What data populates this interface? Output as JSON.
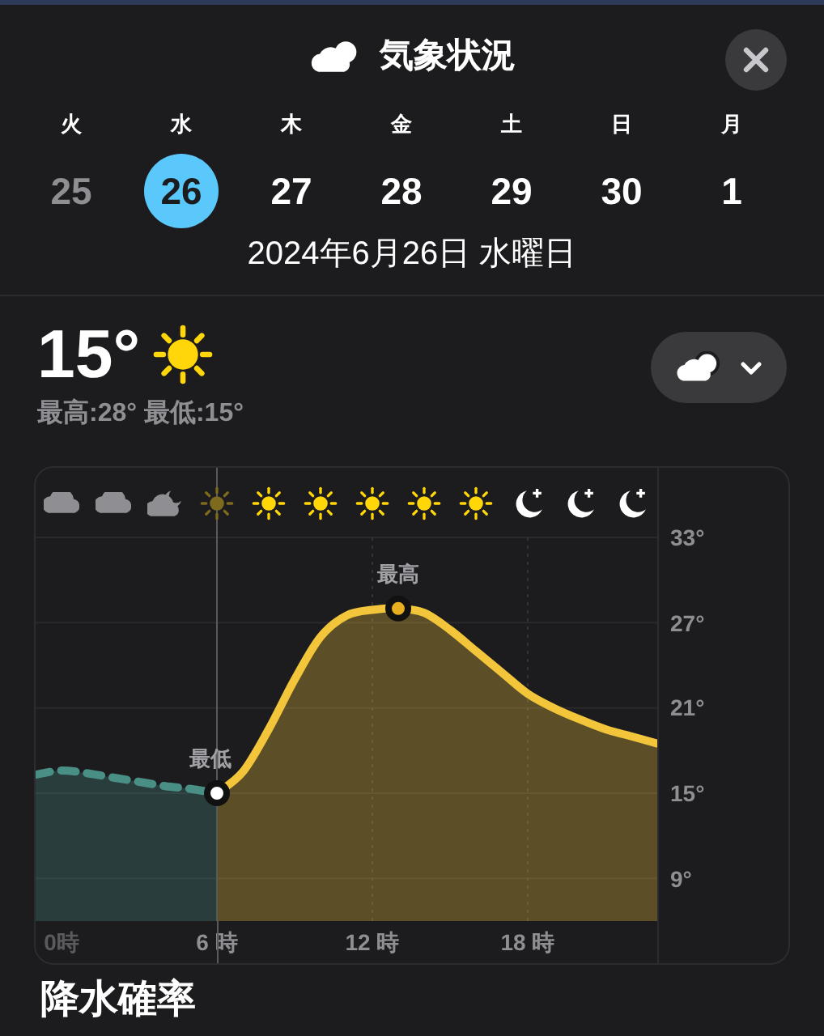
{
  "header": {
    "title": "気象状況"
  },
  "days": [
    {
      "weekday": "火",
      "date": "25",
      "selected": false,
      "past": true
    },
    {
      "weekday": "水",
      "date": "26",
      "selected": true,
      "past": false
    },
    {
      "weekday": "木",
      "date": "27",
      "selected": false,
      "past": false
    },
    {
      "weekday": "金",
      "date": "28",
      "selected": false,
      "past": false
    },
    {
      "weekday": "土",
      "date": "29",
      "selected": false,
      "past": false
    },
    {
      "weekday": "日",
      "date": "30",
      "selected": false,
      "past": false
    },
    {
      "weekday": "月",
      "date": "1",
      "selected": false,
      "past": false
    }
  ],
  "selected_date": "2024年6月26日 水曜日",
  "current": {
    "temperature": "15°",
    "high_low": "最高:28° 最低:15°"
  },
  "hourly_icons": [
    {
      "kind": "cloud"
    },
    {
      "kind": "cloud"
    },
    {
      "kind": "cloud-moon"
    },
    {
      "kind": "sun"
    },
    {
      "kind": "sun"
    },
    {
      "kind": "sun"
    },
    {
      "kind": "sun"
    },
    {
      "kind": "sun"
    },
    {
      "kind": "sun"
    },
    {
      "kind": "moon"
    },
    {
      "kind": "moon"
    },
    {
      "kind": "moon"
    }
  ],
  "chart_data": {
    "type": "area",
    "x": [
      -1,
      0,
      1,
      2,
      3,
      4,
      5,
      6,
      7,
      8,
      9,
      10,
      11,
      12,
      13,
      14,
      15,
      16,
      17,
      18,
      19,
      20,
      21,
      22,
      23
    ],
    "series": [
      {
        "color": "#4a8f86",
        "values": [
          16.3,
          16.6,
          16.4,
          16.1,
          15.8,
          15.5,
          15.3,
          15,
          null,
          null,
          null,
          null,
          null,
          null,
          null,
          null,
          null,
          null,
          null,
          null,
          null,
          null,
          null,
          null,
          null
        ]
      },
      {
        "color": "#f2c53a",
        "values": [
          null,
          null,
          null,
          null,
          null,
          null,
          null,
          15,
          16.5,
          19.5,
          23,
          26,
          27.5,
          27.9,
          28,
          27.7,
          26.5,
          25,
          23.5,
          22,
          21,
          20.2,
          19.5,
          19,
          18.5
        ]
      }
    ],
    "xlim": [
      -1,
      23
    ],
    "ylim": [
      6,
      37.9
    ],
    "xticks": [
      {
        "value": 0,
        "label": "0時"
      },
      {
        "value": 6,
        "label": "6 時"
      },
      {
        "value": 12,
        "label": "12 時"
      },
      {
        "value": 18,
        "label": "18 時"
      }
    ],
    "yticks": [
      {
        "value": 33,
        "label": "33°"
      },
      {
        "value": 27,
        "label": "27°"
      },
      {
        "value": 21,
        "label": "21°"
      },
      {
        "value": 15,
        "label": "15°"
      },
      {
        "value": 9,
        "label": "9°"
      }
    ],
    "ref_lines": [
      {
        "axis": "x",
        "value": 6
      }
    ],
    "grid": true
  },
  "extremes": [
    {
      "kind": "low",
      "label": "最低"
    },
    {
      "kind": "high",
      "label": "最高"
    }
  ],
  "next_section": {
    "title": "降水確率"
  }
}
